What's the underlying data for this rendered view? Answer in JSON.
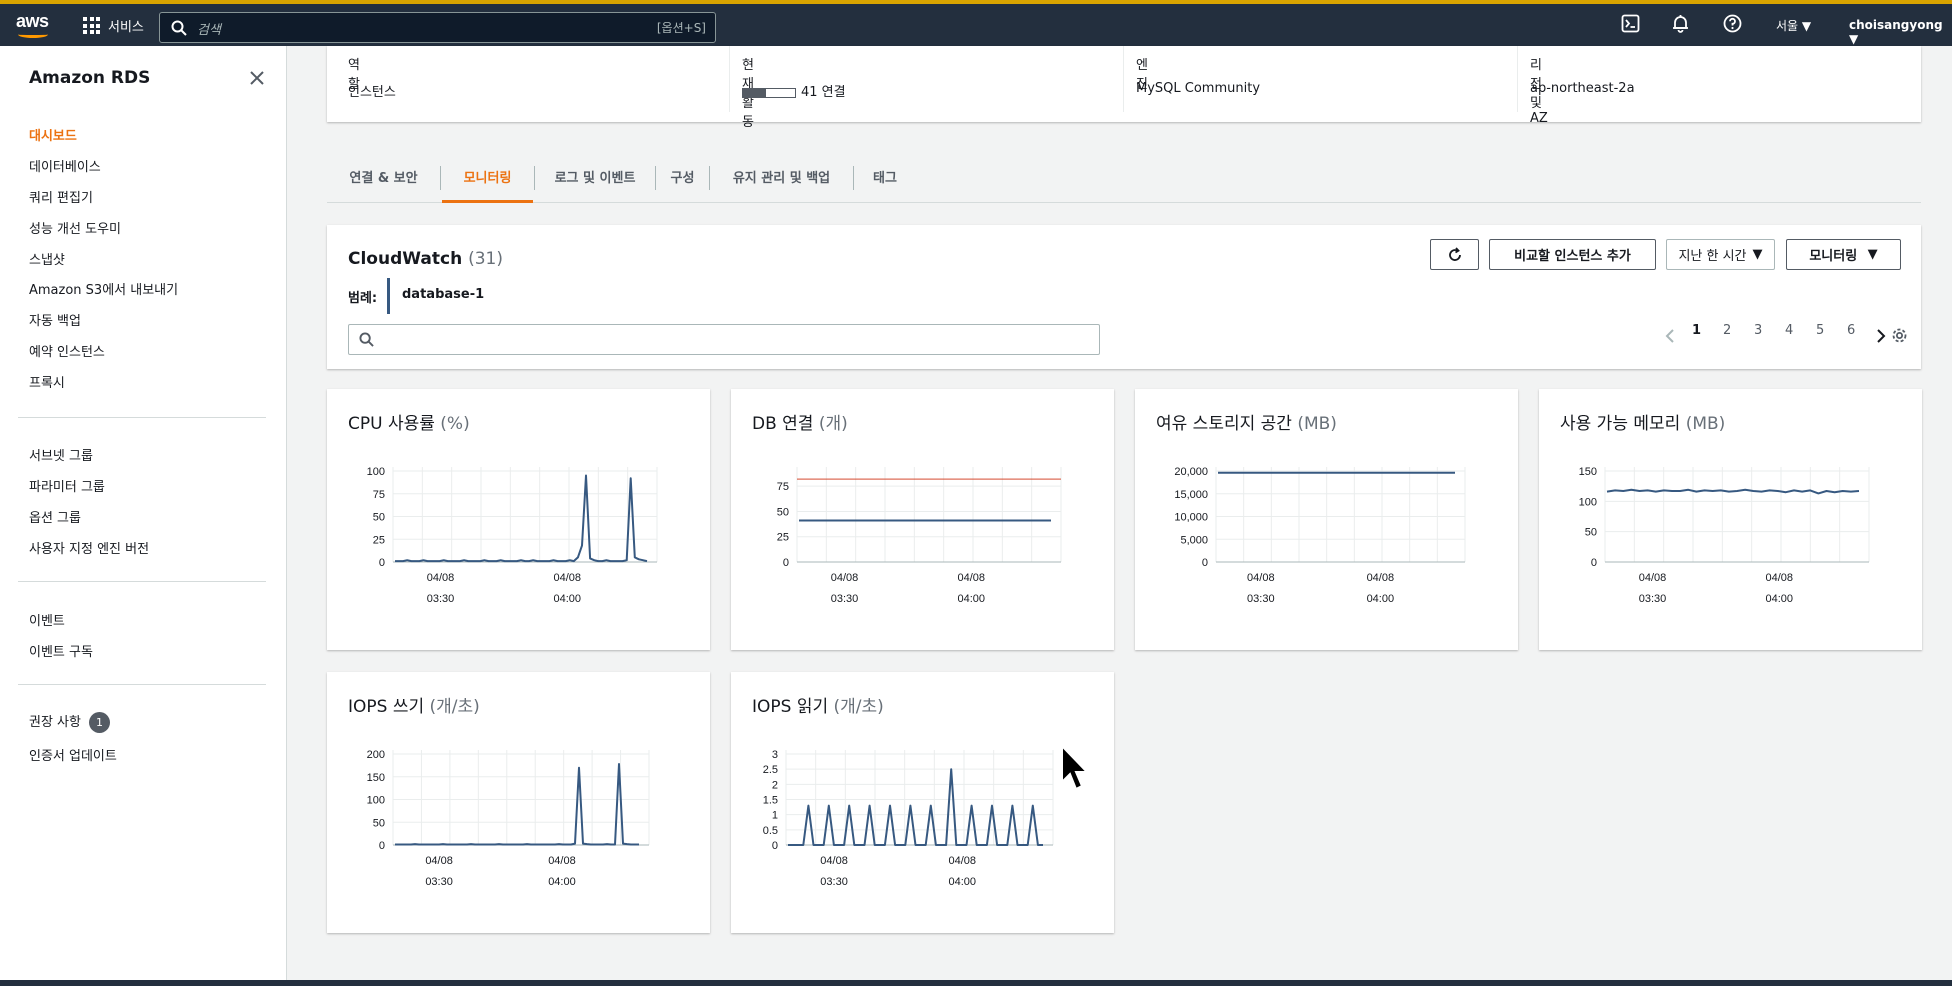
{
  "topnav": {
    "logo_text": "aws",
    "services_label": "서비스",
    "search_placeholder": "검색",
    "search_shortcut": "[옵션+S]",
    "region": "서울",
    "user": "choisangyong",
    "icons": [
      "cloudshell-icon",
      "bell-icon",
      "help-icon"
    ]
  },
  "sidebar": {
    "title": "Amazon RDS",
    "groups": [
      [
        {
          "label": "대시보드",
          "active": true
        },
        {
          "label": "데이터베이스"
        },
        {
          "label": "쿼리 편집기"
        },
        {
          "label": "성능 개선 도우미"
        },
        {
          "label": "스냅샷"
        },
        {
          "label": "Amazon S3에서 내보내기"
        },
        {
          "label": "자동 백업"
        },
        {
          "label": "예약 인스턴스"
        },
        {
          "label": "프록시"
        }
      ],
      [
        {
          "label": "서브넷 그룹"
        },
        {
          "label": "파라미터 그룹"
        },
        {
          "label": "옵션 그룹"
        },
        {
          "label": "사용자 지정 엔진 버전"
        }
      ],
      [
        {
          "label": "이벤트"
        },
        {
          "label": "이벤트 구독"
        }
      ],
      [
        {
          "label": "권장 사항",
          "badge": "1"
        },
        {
          "label": "인증서 업데이트"
        }
      ]
    ]
  },
  "summary": {
    "columns": [
      {
        "key": "역할",
        "value": "인스턴스"
      },
      {
        "key": "현재 활동",
        "value": "41 연결",
        "bar_fraction": 0.45
      },
      {
        "key": "엔진",
        "value": "MySQL Community"
      },
      {
        "key": "리전 및 AZ",
        "value": "ap-northeast-2a"
      }
    ]
  },
  "tabs": [
    {
      "label": "연결 & 보안"
    },
    {
      "label": "모니터링",
      "active": true
    },
    {
      "label": "로그 및 이벤트"
    },
    {
      "label": "구성"
    },
    {
      "label": "유지 관리 및 백업"
    },
    {
      "label": "태그"
    }
  ],
  "cloudwatch": {
    "title": "CloudWatch",
    "count": "(31)",
    "legend_label": "범례:",
    "legend_item": "database-1",
    "compare_button": "비교할 인스턴스 추가",
    "time_select": "지난 한 시간",
    "monitoring_button": "모니터링",
    "pages": [
      "1",
      "2",
      "3",
      "4",
      "5",
      "6"
    ],
    "active_page": "1"
  },
  "colors": {
    "accent": "#ec7211",
    "series": "#375981",
    "threshold": "#d13212",
    "nav_bg": "#232f3e"
  },
  "chart_data": [
    {
      "type": "line",
      "title": "CPU 사용률",
      "unit": "(%)",
      "x_ticks": [
        [
          "04/08",
          "03:30"
        ],
        [
          "04/08",
          "04:00"
        ]
      ],
      "y_ticks": [
        "0",
        "25",
        "50",
        "75",
        "100"
      ],
      "ylim": [
        0,
        100
      ],
      "series": [
        {
          "values": [
            1,
            1,
            1,
            2,
            1,
            1,
            1,
            2,
            1,
            1,
            1,
            1,
            2,
            1,
            1,
            1,
            1,
            2,
            1,
            1,
            1,
            1,
            2,
            1,
            1,
            1,
            2,
            1,
            1,
            1,
            1,
            2,
            1,
            1,
            2,
            1,
            1,
            1,
            1,
            2,
            1,
            1,
            1,
            2,
            1,
            5,
            18,
            95,
            4,
            2,
            1,
            1,
            2,
            1,
            1,
            1,
            1,
            2,
            92,
            5,
            3,
            2,
            1
          ]
        }
      ]
    },
    {
      "type": "line",
      "title": "DB 연결",
      "unit": "(개)",
      "x_ticks": [
        [
          "04/08",
          "03:30"
        ],
        [
          "04/08",
          "04:00"
        ]
      ],
      "y_ticks": [
        "0",
        "25",
        "50",
        "75"
      ],
      "ylim": [
        0,
        90
      ],
      "threshold": 82,
      "series": [
        {
          "values": [
            41,
            41,
            41,
            41,
            41,
            41,
            41,
            41,
            41,
            41,
            41,
            41,
            41,
            41,
            41,
            41,
            41,
            41,
            41,
            41,
            41,
            41
          ]
        }
      ]
    },
    {
      "type": "line",
      "title": "여유 스토리지 공간",
      "unit": "(MB)",
      "x_ticks": [
        [
          "04/08",
          "03:30"
        ],
        [
          "04/08",
          "04:00"
        ]
      ],
      "y_ticks": [
        "0",
        "5,000",
        "10,000",
        "15,000",
        "20,000"
      ],
      "ylim": [
        0,
        20000
      ],
      "series": [
        {
          "values": [
            19600,
            19600,
            19600,
            19600,
            19600,
            19600,
            19600,
            19600,
            19600,
            19600,
            19600,
            19600,
            19600,
            19600,
            19600,
            19600
          ]
        }
      ]
    },
    {
      "type": "line",
      "title": "사용 가능 메모리",
      "unit": "(MB)",
      "x_ticks": [
        [
          "04/08",
          "03:30"
        ],
        [
          "04/08",
          "04:00"
        ]
      ],
      "y_ticks": [
        "0",
        "50",
        "100",
        "150"
      ],
      "ylim": [
        0,
        150
      ],
      "series": [
        {
          "values": [
            116,
            118,
            117,
            119,
            117,
            118,
            116,
            118,
            117,
            117,
            119,
            116,
            118,
            117,
            118,
            116,
            117,
            119,
            117,
            116,
            118,
            117,
            115,
            118,
            116,
            118,
            113,
            117,
            115,
            117,
            116,
            117
          ]
        }
      ]
    },
    {
      "type": "line",
      "title": "IOPS 쓰기",
      "unit": "(개/초)",
      "x_ticks": [
        [
          "04/08",
          "03:30"
        ],
        [
          "04/08",
          "04:00"
        ]
      ],
      "y_ticks": [
        "0",
        "50",
        "100",
        "150",
        "200"
      ],
      "ylim": [
        0,
        200
      ],
      "series": [
        {
          "values": [
            1,
            1,
            1,
            1,
            1,
            2,
            1,
            1,
            1,
            1,
            1,
            1,
            2,
            1,
            1,
            1,
            1,
            1,
            1,
            2,
            1,
            1,
            1,
            1,
            1,
            1,
            2,
            1,
            1,
            1,
            1,
            1,
            1,
            2,
            1,
            1,
            1,
            1,
            1,
            1,
            1,
            2,
            1,
            1,
            1,
            3,
            170,
            3,
            2,
            1,
            1,
            1,
            1,
            2,
            1,
            1,
            178,
            3,
            2,
            1,
            1,
            1
          ]
        }
      ]
    },
    {
      "type": "line",
      "title": "IOPS 읽기",
      "unit": "(개/초)",
      "x_ticks": [
        [
          "04/08",
          "03:30"
        ],
        [
          "04/08",
          "04:00"
        ]
      ],
      "y_ticks": [
        "0",
        "0.5",
        "1",
        "1.5",
        "2",
        "2.5",
        "3"
      ],
      "ylim": [
        0,
        3
      ],
      "series": [
        {
          "values": [
            0,
            0,
            0,
            0,
            1.3,
            0,
            0,
            0,
            1.3,
            0,
            0,
            0,
            1.3,
            0,
            0,
            0,
            1.3,
            0,
            0,
            0,
            1.3,
            0,
            0,
            0,
            1.3,
            0,
            0,
            0,
            1.3,
            0,
            0,
            0,
            2.5,
            0,
            0,
            0,
            1.3,
            0,
            0,
            0,
            1.3,
            0,
            0,
            0,
            1.3,
            0,
            0,
            0,
            1.3,
            0,
            0
          ]
        }
      ]
    }
  ]
}
